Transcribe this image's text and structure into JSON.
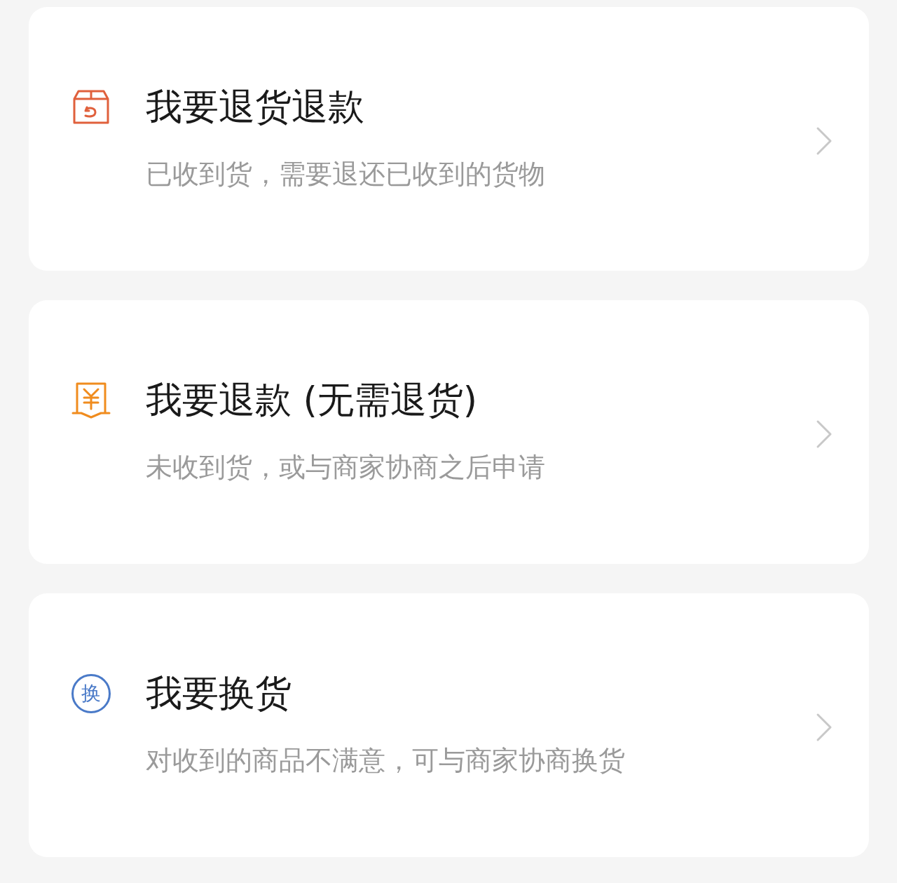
{
  "options": [
    {
      "kind": "box",
      "title": "我要退货退款",
      "subtitle": "已收到货，需要退还已收到的货物"
    },
    {
      "kind": "yen",
      "title": "我要退款 (无需退货)",
      "subtitle": "未收到货，或与商家协商之后申请"
    },
    {
      "kind": "swap",
      "glyph": "换",
      "title": "我要换货",
      "subtitle": "对收到的商品不满意，可与商家协商换货"
    }
  ]
}
